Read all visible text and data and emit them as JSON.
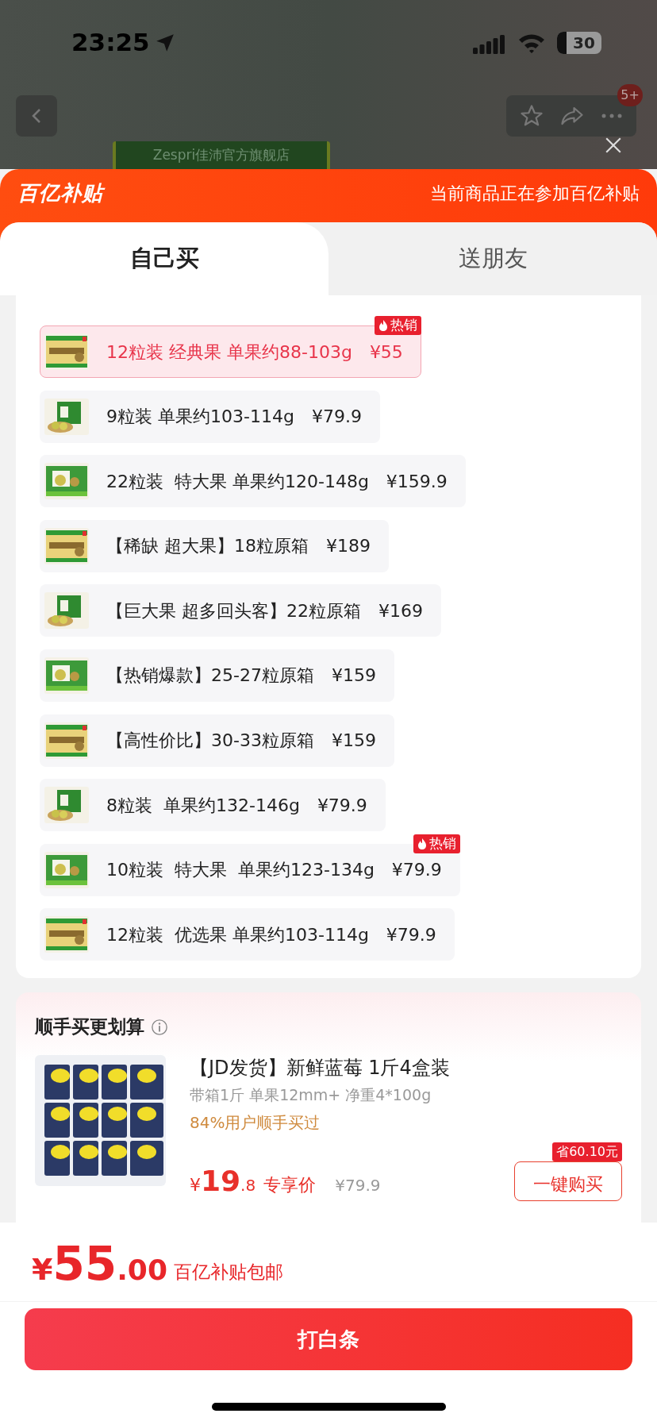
{
  "status_bar": {
    "time": "23:25",
    "battery": "30"
  },
  "nav": {
    "badge": "5+"
  },
  "store": {
    "name": "Zespri佳沛官方旗舰店"
  },
  "sheet": {
    "logo": "百亿补贴",
    "notice": "当前商品正在参加百亿补贴"
  },
  "tabs": [
    {
      "label": "自己买",
      "selected": true
    },
    {
      "label": "送朋友",
      "selected": false
    }
  ],
  "variants": [
    {
      "label": "12粒装 经典果 单果约88-103g",
      "price": "¥55",
      "selected": true,
      "badge": "热销"
    },
    {
      "label": "9粒装 单果约103-114g",
      "price": "¥79.9",
      "selected": false
    },
    {
      "label": "22粒装  特大果 单果约120-148g",
      "price": "¥159.9",
      "selected": false
    },
    {
      "label": "【稀缺 超大果】18粒原箱",
      "price": "¥189",
      "selected": false
    },
    {
      "label": "【巨大果 超多回头客】22粒原箱",
      "price": "¥169",
      "selected": false
    },
    {
      "label": "【热销爆款】25-27粒原箱",
      "price": "¥159",
      "selected": false
    },
    {
      "label": "【高性价比】30-33粒原箱",
      "price": "¥159",
      "selected": false
    },
    {
      "label": "8粒装  单果约132-146g",
      "price": "¥79.9",
      "selected": false
    },
    {
      "label": "10粒装  特大果  单果约123-134g",
      "price": "¥79.9",
      "selected": false,
      "badge": "热销"
    },
    {
      "label": "12粒装  优选果 单果约103-114g",
      "price": "¥79.9",
      "selected": false
    }
  ],
  "addon": {
    "title": "顺手买更划算",
    "name": "【JD发货】新鲜蓝莓 1斤4盒装",
    "spec": "带箱1斤 单果12mm+ 净重4*100g",
    "bought": "84%用户顺手买过",
    "currency": "¥",
    "price_int": "19",
    "price_dec": ".8",
    "price_label": "专享价",
    "original_price": "¥79.9",
    "save_tag": "省60.10元",
    "button": "一键购买"
  },
  "footer": {
    "currency": "¥",
    "amount_int": "55",
    "amount_dec": ".00",
    "note": "百亿补贴包邮",
    "button": "打白条"
  }
}
